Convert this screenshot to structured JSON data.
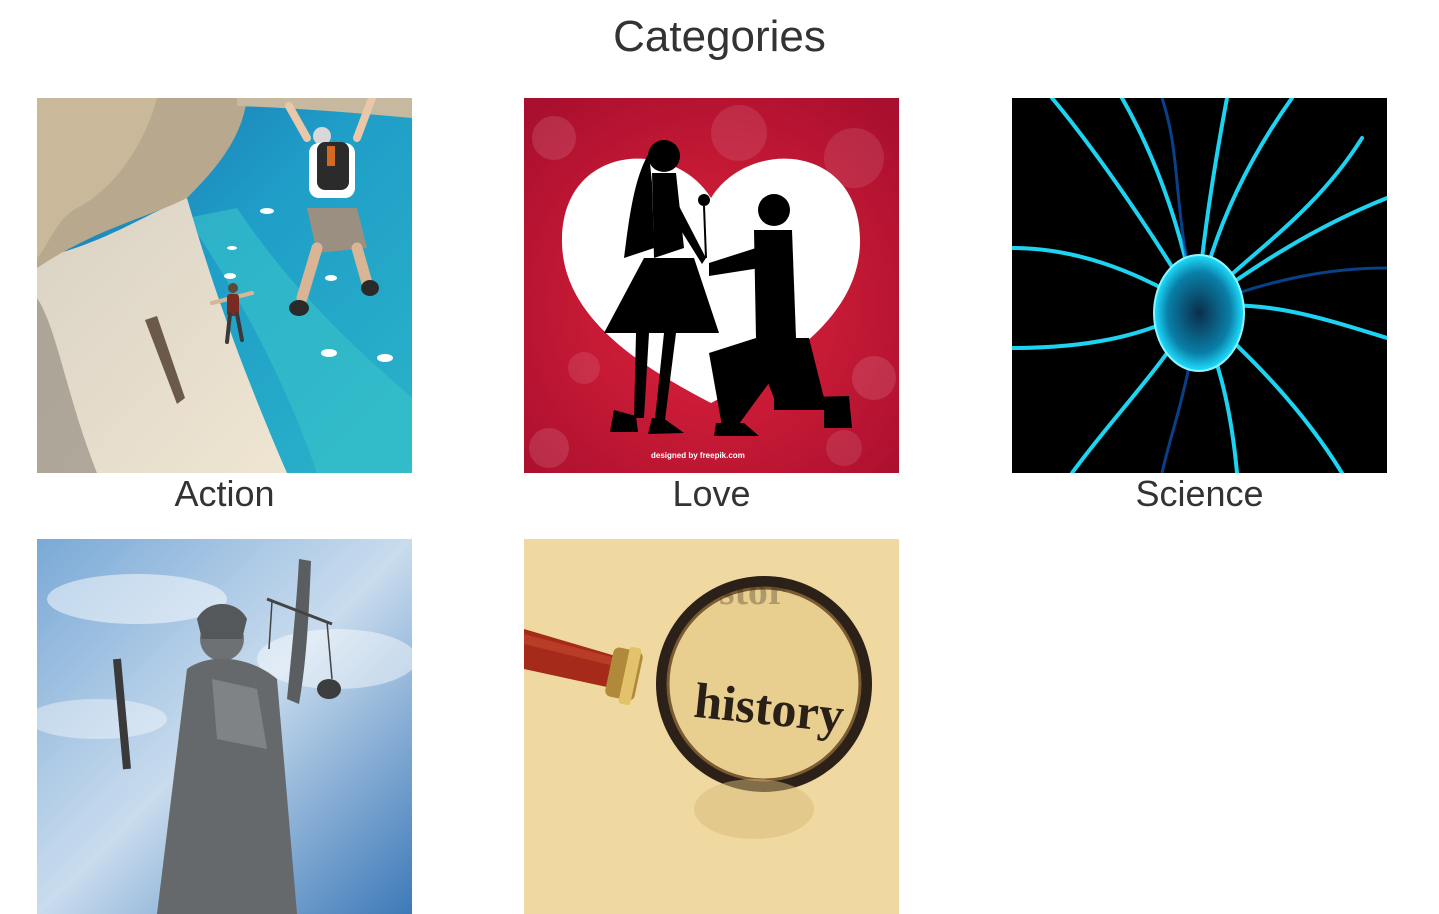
{
  "page": {
    "title": "Categories"
  },
  "categories": [
    {
      "label": "Action",
      "image": "skydivers-over-beach-image"
    },
    {
      "label": "Love",
      "image": "couple-proposal-heart-image"
    },
    {
      "label": "Science",
      "image": "plasma-ball-image"
    },
    {
      "label": "",
      "image": "lady-justice-statue-image"
    },
    {
      "label": "",
      "image": "magnifying-glass-history-image"
    }
  ],
  "image_text": {
    "love_credit": "designed by freepik.com",
    "history_word": "history",
    "history_faded": "stor"
  },
  "colors": {
    "text": "#333333",
    "background": "#ffffff",
    "love_red": "#c8102e",
    "science_cyan": "#1ee0ff",
    "history_bg": "#f0d9a0"
  }
}
